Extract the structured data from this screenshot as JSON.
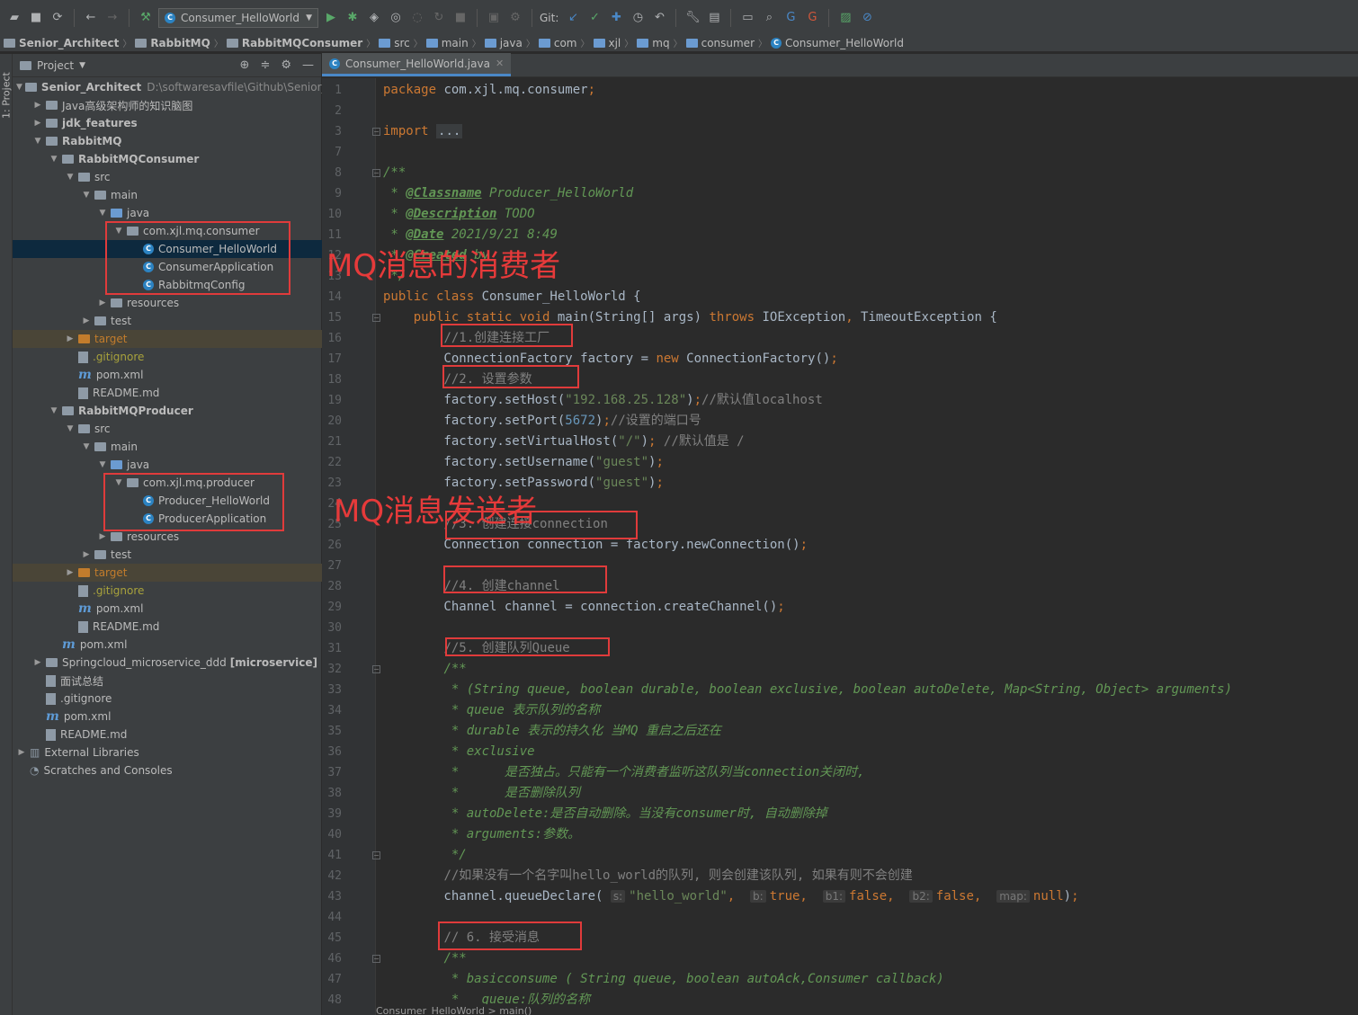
{
  "toolbar": {
    "run_config": "Consumer_HelloWorld",
    "git_label": "Git:"
  },
  "breadcrumb": [
    "Senior_Architect",
    "RabbitMQ",
    "RabbitMQConsumer",
    "src",
    "main",
    "java",
    "com",
    "xjl",
    "mq",
    "consumer",
    "Consumer_HelloWorld"
  ],
  "side_tab": "1: Project",
  "project_panel": {
    "title": "Project"
  },
  "tree": [
    {
      "indent": 0,
      "arrow": "down",
      "icon": "module",
      "label": "Senior_Architect",
      "bold": true,
      "extra": "D:\\softwaresavfile\\Github\\Senior_A"
    },
    {
      "indent": 1,
      "arrow": "right",
      "icon": "folder",
      "label": "Java高级架构师的知识脑图"
    },
    {
      "indent": 1,
      "arrow": "right",
      "icon": "module",
      "label": "jdk_features",
      "bold": true
    },
    {
      "indent": 1,
      "arrow": "down",
      "icon": "module",
      "label": "RabbitMQ",
      "bold": true
    },
    {
      "indent": 2,
      "arrow": "down",
      "icon": "module",
      "label": "RabbitMQConsumer",
      "bold": true
    },
    {
      "indent": 3,
      "arrow": "down",
      "icon": "folder",
      "label": "src"
    },
    {
      "indent": 4,
      "arrow": "down",
      "icon": "folder",
      "label": "main"
    },
    {
      "indent": 5,
      "arrow": "down",
      "icon": "folder-blue",
      "label": "java"
    },
    {
      "indent": 6,
      "arrow": "down",
      "icon": "package",
      "label": "com.xjl.mq.consumer"
    },
    {
      "indent": 7,
      "arrow": "none",
      "icon": "class",
      "label": "Consumer_HelloWorld",
      "selected": true
    },
    {
      "indent": 7,
      "arrow": "none",
      "icon": "class",
      "label": "ConsumerApplication"
    },
    {
      "indent": 7,
      "arrow": "none",
      "icon": "class",
      "label": "RabbitmqConfig"
    },
    {
      "indent": 5,
      "arrow": "right",
      "icon": "folder",
      "label": "resources"
    },
    {
      "indent": 4,
      "arrow": "right",
      "icon": "folder",
      "label": "test"
    },
    {
      "indent": 3,
      "arrow": "right",
      "icon": "folder-orange",
      "label": "target",
      "highlight": true,
      "orange": true
    },
    {
      "indent": 3,
      "arrow": "none",
      "icon": "file",
      "label": ".gitignore",
      "git": true
    },
    {
      "indent": 3,
      "arrow": "none",
      "icon": "maven",
      "label": "pom.xml"
    },
    {
      "indent": 3,
      "arrow": "none",
      "icon": "file",
      "label": "README.md"
    },
    {
      "indent": 2,
      "arrow": "down",
      "icon": "module",
      "label": "RabbitMQProducer",
      "bold": true
    },
    {
      "indent": 3,
      "arrow": "down",
      "icon": "folder",
      "label": "src"
    },
    {
      "indent": 4,
      "arrow": "down",
      "icon": "folder",
      "label": "main"
    },
    {
      "indent": 5,
      "arrow": "down",
      "icon": "folder-blue",
      "label": "java"
    },
    {
      "indent": 6,
      "arrow": "down",
      "icon": "package",
      "label": "com.xjl.mq.producer"
    },
    {
      "indent": 7,
      "arrow": "none",
      "icon": "class",
      "label": "Producer_HelloWorld"
    },
    {
      "indent": 7,
      "arrow": "none",
      "icon": "class",
      "label": "ProducerApplication"
    },
    {
      "indent": 5,
      "arrow": "right",
      "icon": "folder",
      "label": "resources"
    },
    {
      "indent": 4,
      "arrow": "right",
      "icon": "folder",
      "label": "test"
    },
    {
      "indent": 3,
      "arrow": "right",
      "icon": "folder-orange",
      "label": "target",
      "highlight": true,
      "orange": true
    },
    {
      "indent": 3,
      "arrow": "none",
      "icon": "file",
      "label": ".gitignore",
      "git": true
    },
    {
      "indent": 3,
      "arrow": "none",
      "icon": "maven",
      "label": "pom.xml"
    },
    {
      "indent": 3,
      "arrow": "none",
      "icon": "file",
      "label": "README.md"
    },
    {
      "indent": 2,
      "arrow": "none",
      "icon": "maven",
      "label": "pom.xml"
    },
    {
      "indent": 1,
      "arrow": "right",
      "icon": "module",
      "label": "Springcloud_microservice_ddd",
      "suffix": "[microservice]"
    },
    {
      "indent": 1,
      "arrow": "none",
      "icon": "file",
      "label": "面试总结"
    },
    {
      "indent": 1,
      "arrow": "none",
      "icon": "file",
      "label": ".gitignore"
    },
    {
      "indent": 1,
      "arrow": "none",
      "icon": "maven",
      "label": "pom.xml"
    },
    {
      "indent": 1,
      "arrow": "none",
      "icon": "file",
      "label": "README.md"
    },
    {
      "indent": 0,
      "arrow": "right",
      "icon": "library",
      "label": "External Libraries"
    },
    {
      "indent": 0,
      "arrow": "none",
      "icon": "scratch",
      "label": "Scratches and Consoles"
    }
  ],
  "editor": {
    "tab_label": "Consumer_HelloWorld.java",
    "line_numbers": [
      "1",
      "2",
      "3",
      "7",
      "8",
      "9",
      "10",
      "11",
      "12",
      "13",
      "14",
      "15",
      "16",
      "17",
      "18",
      "19",
      "20",
      "21",
      "22",
      "23",
      "24",
      "25",
      "26",
      "27",
      "28",
      "29",
      "30",
      "31",
      "32",
      "33",
      "34",
      "35",
      "36",
      "37",
      "38",
      "39",
      "40",
      "41",
      "42",
      "43",
      "44",
      "45",
      "46",
      "47",
      "48"
    ],
    "lines": [
      [
        {
          "c": "kw",
          "t": "package "
        },
        {
          "c": "",
          "t": "com.xjl.mq.consumer"
        },
        {
          "c": "kw",
          "t": ";"
        }
      ],
      [],
      [
        {
          "c": "kw",
          "t": "import "
        },
        {
          "c": "fold-ph",
          "t": "..."
        }
      ],
      [],
      [
        {
          "c": "doc",
          "t": "/**"
        }
      ],
      [
        {
          "c": "doc",
          "t": " * "
        },
        {
          "c": "tag",
          "t": "@Classname"
        },
        {
          "c": "doc",
          "t": " Producer_HelloWorld"
        }
      ],
      [
        {
          "c": "doc",
          "t": " * "
        },
        {
          "c": "tag",
          "t": "@Description"
        },
        {
          "c": "doc",
          "t": " TODO"
        }
      ],
      [
        {
          "c": "doc",
          "t": " * "
        },
        {
          "c": "tag",
          "t": "@Date"
        },
        {
          "c": "doc",
          "t": " 2021/9/21 8:49"
        }
      ],
      [
        {
          "c": "doc",
          "t": " * "
        },
        {
          "c": "tag",
          "t": "@Created"
        },
        {
          "c": "doc",
          "t": " by "
        }
      ],
      [
        {
          "c": "doc",
          "t": " */"
        }
      ],
      [
        {
          "c": "kw",
          "t": "public class "
        },
        {
          "c": "",
          "t": "Consumer_HelloWorld {"
        }
      ],
      [
        {
          "c": "",
          "t": "    "
        },
        {
          "c": "kw",
          "t": "public static void "
        },
        {
          "c": "",
          "t": "main(String[] args) "
        },
        {
          "c": "kw",
          "t": "throws "
        },
        {
          "c": "",
          "t": "IOException"
        },
        {
          "c": "kw",
          "t": ", "
        },
        {
          "c": "",
          "t": "TimeoutException {"
        }
      ],
      [
        {
          "c": "",
          "t": "        "
        },
        {
          "c": "cmt",
          "t": "//1.创建连接工厂"
        }
      ],
      [
        {
          "c": "",
          "t": "        ConnectionFactory factory = "
        },
        {
          "c": "kw",
          "t": "new "
        },
        {
          "c": "",
          "t": "ConnectionFactory()"
        },
        {
          "c": "kw",
          "t": ";"
        }
      ],
      [
        {
          "c": "",
          "t": "        "
        },
        {
          "c": "cmt",
          "t": "//2. 设置参数"
        }
      ],
      [
        {
          "c": "",
          "t": "        factory.setHost("
        },
        {
          "c": "str",
          "t": "\"192.168.25.128\""
        },
        {
          "c": "",
          "t": ")"
        },
        {
          "c": "kw",
          "t": ";"
        },
        {
          "c": "cmt",
          "t": "//默认值localhost"
        }
      ],
      [
        {
          "c": "",
          "t": "        factory.setPort("
        },
        {
          "c": "num",
          "t": "5672"
        },
        {
          "c": "",
          "t": ")"
        },
        {
          "c": "kw",
          "t": ";"
        },
        {
          "c": "cmt",
          "t": "//设置的端口号"
        }
      ],
      [
        {
          "c": "",
          "t": "        factory.setVirtualHost("
        },
        {
          "c": "str",
          "t": "\"/\""
        },
        {
          "c": "",
          "t": ")"
        },
        {
          "c": "kw",
          "t": "; "
        },
        {
          "c": "cmt",
          "t": "//默认值是 /"
        }
      ],
      [
        {
          "c": "",
          "t": "        factory.setUsername("
        },
        {
          "c": "str",
          "t": "\"guest\""
        },
        {
          "c": "",
          "t": ")"
        },
        {
          "c": "kw",
          "t": ";"
        }
      ],
      [
        {
          "c": "",
          "t": "        factory.setPassword("
        },
        {
          "c": "str",
          "t": "\"guest\""
        },
        {
          "c": "",
          "t": ")"
        },
        {
          "c": "kw",
          "t": ";"
        }
      ],
      [],
      [
        {
          "c": "",
          "t": "        "
        },
        {
          "c": "cmt",
          "t": "//3. 创建连接connection"
        }
      ],
      [
        {
          "c": "",
          "t": "        Connection connection = factory.newConnection()"
        },
        {
          "c": "kw",
          "t": ";"
        }
      ],
      [],
      [
        {
          "c": "",
          "t": "        "
        },
        {
          "c": "cmt",
          "t": "//4. 创建channel"
        }
      ],
      [
        {
          "c": "",
          "t": "        Channel channel = connection.createChannel()"
        },
        {
          "c": "kw",
          "t": ";"
        }
      ],
      [],
      [
        {
          "c": "",
          "t": "        "
        },
        {
          "c": "cmt",
          "t": "//5. 创建队列Queue"
        }
      ],
      [
        {
          "c": "",
          "t": "        "
        },
        {
          "c": "doc",
          "t": "/**"
        }
      ],
      [
        {
          "c": "doc",
          "t": "         * (String queue, boolean durable, boolean exclusive, boolean autoDelete, Map<String, Object> arguments)"
        }
      ],
      [
        {
          "c": "doc",
          "t": "         * queue 表示队列的名称"
        }
      ],
      [
        {
          "c": "doc",
          "t": "         * durable 表示的持久化 当MQ 重启之后还在"
        }
      ],
      [
        {
          "c": "doc",
          "t": "         * exclusive"
        }
      ],
      [
        {
          "c": "doc",
          "t": "         *      是否独占。只能有一个消费者监听这队列当connection关闭时,"
        }
      ],
      [
        {
          "c": "doc",
          "t": "         *      是否删除队列"
        }
      ],
      [
        {
          "c": "doc",
          "t": "         * autoDelete:是否自动删除。当没有consumer时, 自动删除掉"
        }
      ],
      [
        {
          "c": "doc",
          "t": "         * arguments:参数。"
        }
      ],
      [
        {
          "c": "doc",
          "t": "         */"
        }
      ],
      [
        {
          "c": "",
          "t": "        "
        },
        {
          "c": "cmt",
          "t": "//如果没有一个名字叫hello_world的队列, 则会创建该队列, 如果有则不会创建"
        }
      ],
      [
        {
          "c": "",
          "t": "        channel.queueDeclare( "
        },
        {
          "c": "hint",
          "t": "s:"
        },
        {
          "c": "str",
          "t": "\"hello_world\""
        },
        {
          "c": "kw",
          "t": ",  "
        },
        {
          "c": "hint",
          "t": "b:"
        },
        {
          "c": "kw",
          "t": "true,  "
        },
        {
          "c": "hint",
          "t": "b1:"
        },
        {
          "c": "kw",
          "t": "false,  "
        },
        {
          "c": "hint",
          "t": "b2:"
        },
        {
          "c": "kw",
          "t": "false,  "
        },
        {
          "c": "hint",
          "t": "map:"
        },
        {
          "c": "kw",
          "t": "null"
        },
        {
          "c": "",
          "t": ")"
        },
        {
          "c": "kw",
          "t": ";"
        }
      ],
      [],
      [
        {
          "c": "",
          "t": "        "
        },
        {
          "c": "cmt",
          "t": "// 6. 接受消息"
        }
      ],
      [
        {
          "c": "",
          "t": "        "
        },
        {
          "c": "doc",
          "t": "/**"
        }
      ],
      [
        {
          "c": "doc",
          "t": "         * basicconsume ( String queue, boolean autoAck,Consumer callback)"
        }
      ],
      [
        {
          "c": "doc",
          "t": "         *   queue:队列的名称"
        }
      ]
    ],
    "folds": [
      "3",
      "8",
      "15",
      "32",
      "41",
      "46"
    ]
  },
  "annotations": {
    "consumer_label": "MQ消息的消费者",
    "producer_label": "MQ消息发送者"
  },
  "status_breadcrumb": "Consumer_HelloWorld  >  main()",
  "colors": {
    "annotation_red": "#e03b3b",
    "selection": "#0d293e",
    "accent_tab": "#4a88c7"
  }
}
